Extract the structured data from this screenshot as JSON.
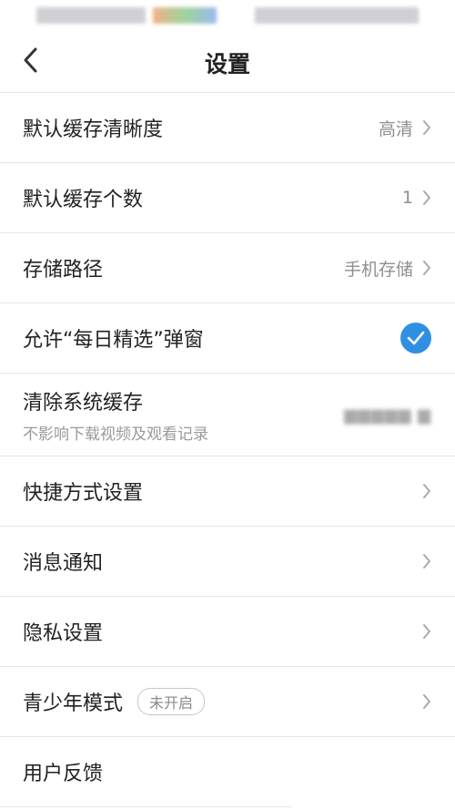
{
  "header": {
    "title": "设置"
  },
  "settings": {
    "cache_quality": {
      "label": "默认缓存清晰度",
      "value": "高清"
    },
    "cache_count": {
      "label": "默认缓存个数",
      "value": "1"
    },
    "storage_path": {
      "label": "存储路径",
      "value": "手机存储"
    },
    "daily_popup": {
      "label": "允许“每日精选”弹窗",
      "checked": true
    },
    "clear_cache": {
      "label": "清除系统缓存",
      "subtitle": "不影响下载视频及观看记录"
    },
    "shortcut": {
      "label": "快捷方式设置"
    },
    "notifications": {
      "label": "消息通知"
    },
    "privacy": {
      "label": "隐私设置"
    },
    "youth_mode": {
      "label": "青少年模式",
      "badge": "未开启"
    },
    "feedback": {
      "label": "用户反馈"
    }
  },
  "colors": {
    "accent": "#2f8fe3",
    "divider": "#e6e6e6",
    "secondary_text": "#8f8f8f"
  }
}
